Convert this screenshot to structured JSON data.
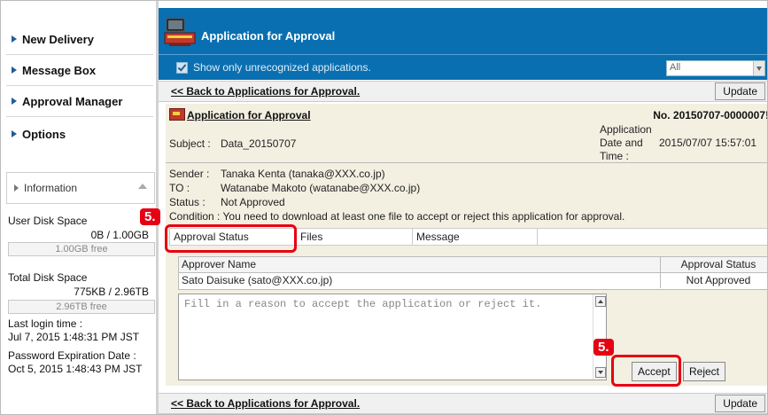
{
  "sidebar": {
    "items": [
      {
        "label": "New Delivery"
      },
      {
        "label": "Message Box"
      },
      {
        "label": "Approval Manager"
      },
      {
        "label": "Options"
      }
    ],
    "info_header": "Information",
    "user_disk": {
      "label": "User Disk Space",
      "value": "0B / 1.00GB",
      "free": "1.00GB free"
    },
    "total_disk": {
      "label": "Total Disk Space",
      "value": "775KB / 2.96TB",
      "free": "2.96TB free"
    },
    "last_login": {
      "label": "Last login time :",
      "value": "Jul 7, 2015 1:48:31 PM JST"
    },
    "password_exp": {
      "label": "Password Expiration Date :",
      "value": "Oct 5, 2015 1:48:43 PM JST"
    }
  },
  "header": {
    "title": "Application for Approval"
  },
  "filter": {
    "checkbox_label": "Show only unrecognized applications.",
    "select_value": "All"
  },
  "back_link": "<< Back to Applications for Approval.",
  "update_label": "Update",
  "panel": {
    "title": "Application for Approval",
    "number": "No. 20150707-0000007!",
    "subject_label": "Subject :",
    "subject": "Data_20150707",
    "date_label_1": "Application",
    "date_label_2": "Date and",
    "date_label_3": "Time :",
    "date": "2015/07/07 15:57:01",
    "sender_label": "Sender :",
    "sender": "Tanaka Kenta (tanaka@XXX.co.jp)",
    "to_label": "TO :",
    "to": "Watanabe Makoto (watanabe@XXX.co.jp)",
    "status_label": "Status :",
    "status": "Not Approved",
    "condition": "Condition : You need to download at least one file to accept or reject this application for approval."
  },
  "tabs": [
    {
      "label": "Approval Status"
    },
    {
      "label": "Files"
    },
    {
      "label": "Message"
    }
  ],
  "approver_table": {
    "headers": [
      "Approver Name",
      "Approval Status"
    ],
    "rows": [
      [
        "Sato Daisuke (sato@XXX.co.jp)",
        "Not Approved"
      ]
    ]
  },
  "reason_placeholder": "Fill in a reason to accept the application or reject it.",
  "buttons": {
    "accept": "Accept",
    "reject": "Reject"
  },
  "callouts": [
    "5.",
    "5."
  ],
  "colors": {
    "header_blue": "#0a6fb0",
    "callout_red": "#e60012",
    "panel_bg": "#f3f0e2"
  }
}
